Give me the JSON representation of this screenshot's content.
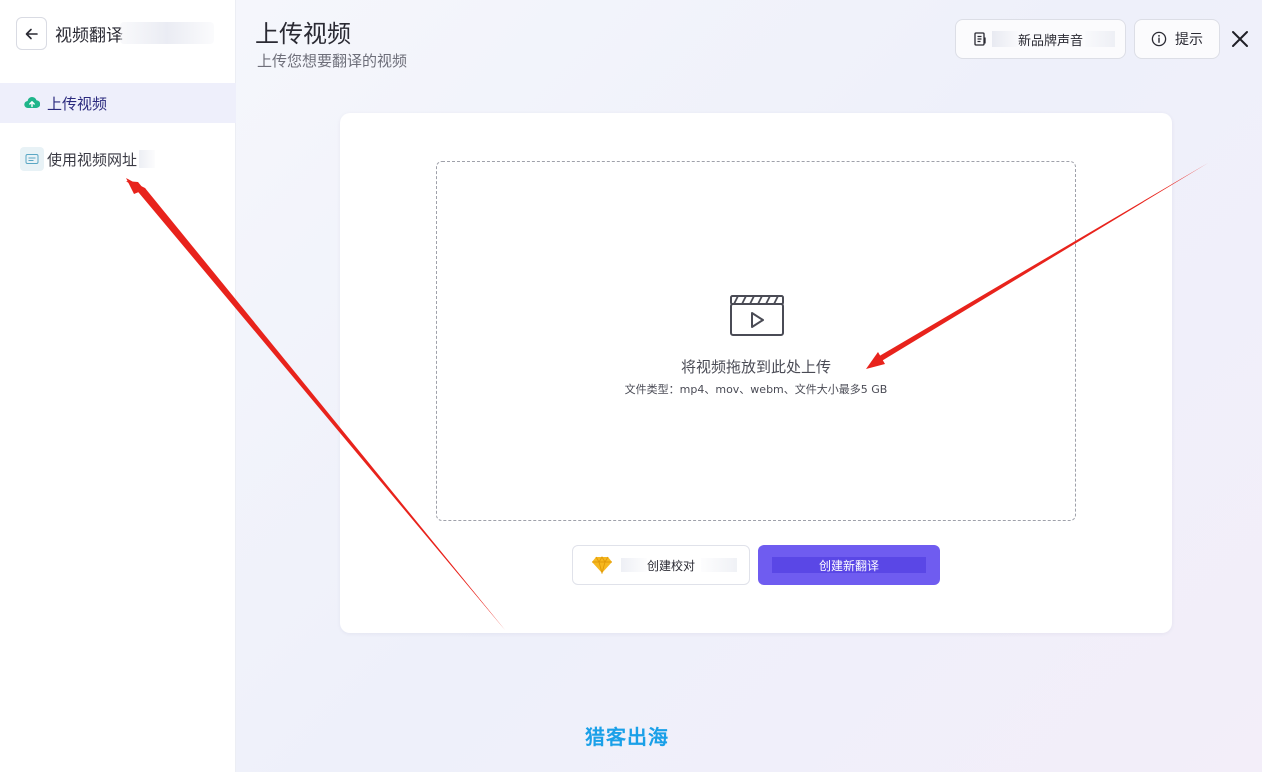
{
  "sidebar": {
    "title": "视频翻译",
    "items": [
      {
        "label": "上传视频",
        "icon": "cloud-upload-icon",
        "active": true
      },
      {
        "label": "使用视频网址",
        "icon": "link-card-icon",
        "active": false
      }
    ]
  },
  "header": {
    "title": "上传视频",
    "subtitle": "上传您想要翻译的视频",
    "brand_voice_label": "新品牌声音",
    "tips_label": "提示"
  },
  "upload": {
    "title": "将视频拖放到此处上传",
    "hint": "文件类型：mp4、mov、webm、文件大小最多5 GB"
  },
  "actions": {
    "proofread_label": "创建校对",
    "new_translation_label": "创建新翻译"
  },
  "watermark": "猎客出海",
  "colors": {
    "accent": "#6f5cf0",
    "active_nav_bg": "#eeeffb",
    "annotation_arrow": "#e8231c",
    "watermark": "#1aa0e8"
  }
}
